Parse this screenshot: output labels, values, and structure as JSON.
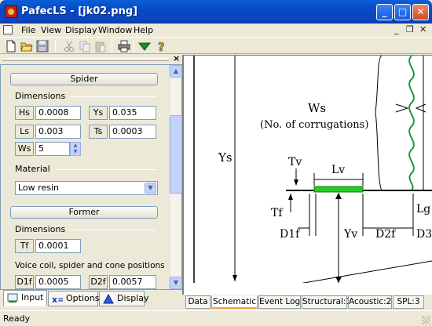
{
  "window": {
    "title": "PafecLS - [jk02.png]",
    "controls": {
      "minimize": "_",
      "maximize": "□",
      "close": "✕"
    }
  },
  "menu": {
    "items": [
      "File",
      "View",
      "Display",
      "Window",
      "Help"
    ],
    "mdi_controls": {
      "minimize": "_",
      "restore": "❐",
      "close": "✕"
    }
  },
  "toolbar": {
    "icons": [
      "new-icon",
      "open-icon",
      "save-icon",
      "cut-icon",
      "copy-icon",
      "paste-icon",
      "print-icon",
      "down-arrow-icon",
      "help-icon"
    ]
  },
  "left_panel": {
    "close_label": "×",
    "spider": {
      "section_label": "Spider",
      "dimensions_label": "Dimensions",
      "fields": [
        {
          "label": "Hs",
          "value": "0.0008"
        },
        {
          "label": "Ys",
          "value": "0.035"
        },
        {
          "label": "Ls",
          "value": "0.003"
        },
        {
          "label": "Ts",
          "value": "0.0003"
        },
        {
          "label": "Ws",
          "value": "5"
        }
      ],
      "material_label": "Material",
      "material_value": "Low resin"
    },
    "former": {
      "section_label": "Former",
      "dimensions_label": "Dimensions",
      "fields": [
        {
          "label": "Tf",
          "value": "0.0001"
        }
      ],
      "positions_label": "Voice coil, spider and cone positions",
      "position_fields": [
        {
          "label": "D1f",
          "value": "0.0005"
        },
        {
          "label": "D2f",
          "value": "0.0057"
        }
      ]
    }
  },
  "left_tabs": [
    "Input",
    "Options",
    "Display"
  ],
  "schematic": {
    "labels": {
      "ws": "Ws",
      "corrugations": "(No. of corrugations)",
      "ys": "Ys",
      "tv": "Tv",
      "lv": "Lv",
      "tf": "Tf",
      "d1f": "D1f",
      "yv": "Yv",
      "d2f": "D2f",
      "d3_partial": "D3",
      "lg_partial": "Lg"
    },
    "accent_color": "#22cc22",
    "coil_color": "#1a9a3a"
  },
  "document_tabs": [
    "Data",
    "Schematic",
    "Event Log",
    "Structural:1",
    "Acoustic:2",
    "SPL:3"
  ],
  "status": {
    "text": "Ready"
  }
}
